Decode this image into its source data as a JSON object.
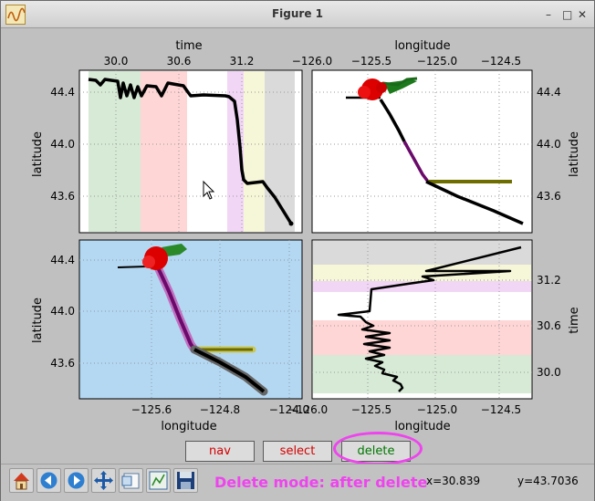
{
  "window": {
    "title": "Figure 1",
    "minimize_glyph": "–",
    "maximize_glyph": "□",
    "close_glyph": "✕"
  },
  "plot": {
    "top_left": {
      "top_axis_label": "time",
      "top_ticks": [
        "30.0",
        "30.6",
        "31.2",
        "−126.0"
      ],
      "left_axis_label": "latitude",
      "left_ticks": [
        "44.4",
        "44.0",
        "43.6"
      ]
    },
    "top_right": {
      "top_axis_label": "longitude",
      "top_ticks": [
        "−125.5",
        "−125.0",
        "−124.5"
      ],
      "right_axis_label": "latitude",
      "right_ticks": [
        "44.4",
        "44.0",
        "43.6"
      ]
    },
    "bottom_left": {
      "bottom_axis_label": "longitude",
      "bottom_ticks": [
        "−125.6",
        "−124.8",
        "−124.0"
      ],
      "left_axis_label": "latitude",
      "left_ticks": [
        "44.4",
        "44.0",
        "43.6"
      ]
    },
    "bottom_right": {
      "bottom_axis_label": "longitude",
      "bottom_ticks": [
        "−126.0",
        "−125.5",
        "−125.0",
        "−124.5"
      ],
      "right_axis_label": "time",
      "right_ticks": [
        "31.2",
        "30.6",
        "30.0"
      ]
    }
  },
  "buttons": {
    "nav": "nav",
    "select": "select",
    "delete": "delete"
  },
  "colors": {
    "nav": "#d40000",
    "select": "#d40000",
    "delete": "#007700",
    "mode": "#ee44ee"
  },
  "toolbar": {
    "icons": [
      "home-icon",
      "back-icon",
      "forward-icon",
      "pan-icon",
      "zoom-icon",
      "subplots-icon",
      "save-icon"
    ],
    "mode_text": "Delete mode: after delete",
    "x_readout": "x=30.839",
    "y_readout": "y=43.7036"
  }
}
